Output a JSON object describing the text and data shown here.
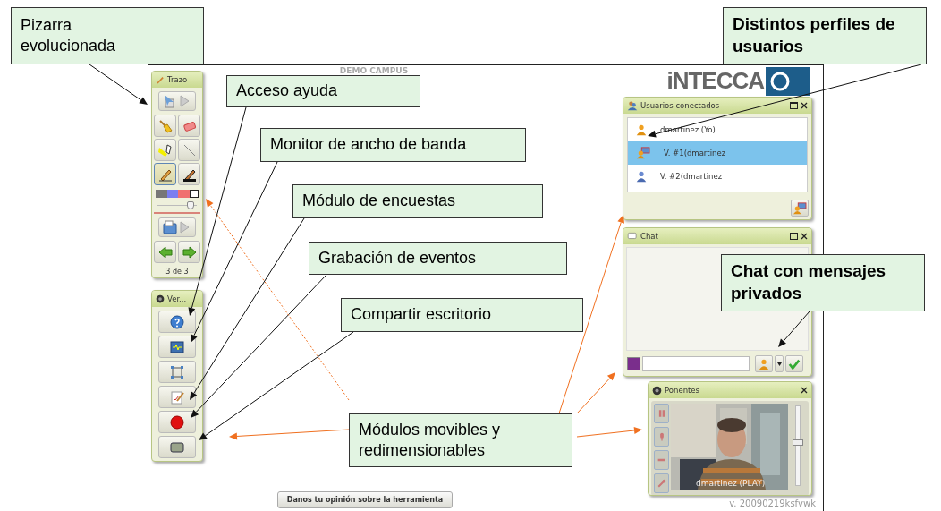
{
  "app": {
    "title": "DEMO CAMPUS",
    "feedback_button": "Danos tu opinión sobre la herramienta",
    "version": "v. 20090219ksfvwk",
    "logo": "iNTECCA"
  },
  "stroke_panel": {
    "title": "Trazo",
    "tools": [
      {
        "kind": "pointer",
        "selected": false
      },
      {
        "kind": "play",
        "selected": false
      },
      {
        "kind": "broom",
        "selected": false
      },
      {
        "kind": "eraser",
        "selected": false
      },
      {
        "kind": "highlighter",
        "selected": false
      },
      {
        "kind": "line",
        "selected": false
      },
      {
        "kind": "pencil",
        "selected": true
      },
      {
        "kind": "pen",
        "selected": false
      }
    ],
    "level": 0.85,
    "page_tools": [
      {
        "kind": "folder"
      },
      {
        "kind": "play"
      },
      {
        "kind": "prev"
      },
      {
        "kind": "next"
      }
    ],
    "page_counter": "3 de 3"
  },
  "view_panel": {
    "title": "Ver...",
    "buttons": [
      {
        "kind": "help"
      },
      {
        "kind": "monitor"
      },
      {
        "kind": "fullscreen"
      },
      {
        "kind": "poll"
      },
      {
        "kind": "record"
      },
      {
        "kind": "desktop"
      }
    ]
  },
  "users_panel": {
    "title": "Usuarios conectados",
    "users": [
      {
        "name": "dmartinez (Yo)",
        "kind": "moderator",
        "selected": false
      },
      {
        "name": "V. #1(dmartinez",
        "kind": "presenter",
        "selected": true
      },
      {
        "name": "V. #2(dmartinez",
        "kind": "viewer",
        "selected": false
      }
    ]
  },
  "chat_panel": {
    "title": "Chat"
  },
  "speakers_panel": {
    "title": "Ponentes",
    "caption": "dmartinez (PLAY)",
    "level": 0.55
  },
  "callouts": [
    {
      "text": "Pizarra evolucionada",
      "bold": false
    },
    {
      "text": "Acceso ayuda",
      "bold": false
    },
    {
      "text": "Monitor de ancho de banda",
      "bold": false
    },
    {
      "text": "Módulo de encuestas",
      "bold": false
    },
    {
      "text": "Grabación de eventos",
      "bold": false
    },
    {
      "text": "Compartir escritorio",
      "bold": false
    },
    {
      "text": "Módulos movibles y redimensionables",
      "bold": false
    },
    {
      "text": "Distintos perfiles de usuarios",
      "bold": true
    },
    {
      "text": "Chat con mensajes privados",
      "bold": true
    }
  ]
}
